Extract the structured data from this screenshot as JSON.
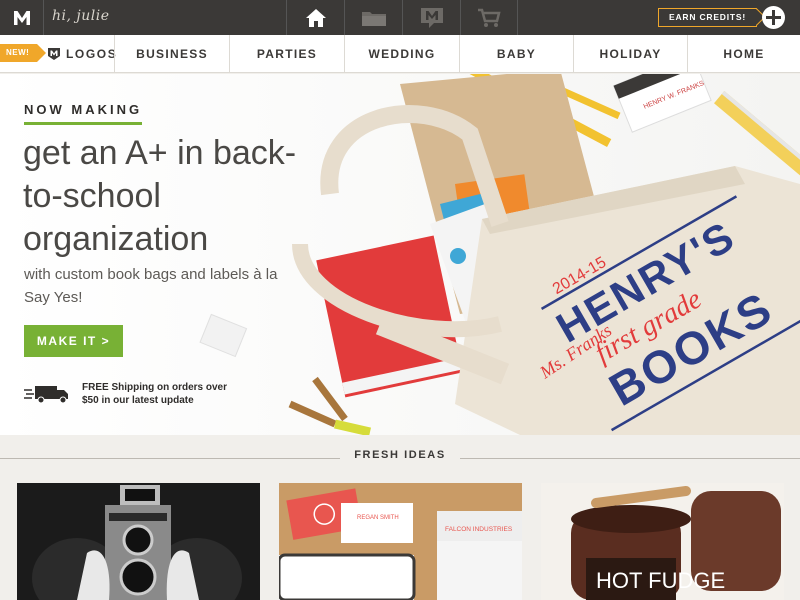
{
  "header": {
    "greeting": "hi, julie",
    "earn_credits": "EARN CREDITS!",
    "icons": [
      "home-icon",
      "folder-icon",
      "message-icon",
      "cart-icon"
    ]
  },
  "nav": {
    "new_badge": "NEW!",
    "logos_label": "LOGOS",
    "items": [
      "BUSINESS",
      "PARTIES",
      "WEDDING",
      "BABY",
      "HOLIDAY",
      "HOME"
    ]
  },
  "hero": {
    "eyebrow": "NOW MAKING",
    "headline": "get an A+ in back-to-school organization",
    "subtext": "with custom book bags and labels à la Say Yes!",
    "cta": "MAKE IT >",
    "shipping": "FREE Shipping on orders over $50 in our latest update",
    "bag_year": "2014-15",
    "bag_name": "HENRY'S",
    "bag_grade": "first grade",
    "bag_books": "BOOKS",
    "bag_teacher": "Ms. Franks"
  },
  "fresh": {
    "title": "FRESH IDEAS",
    "card2_brand": "FALCON INDUSTRIES",
    "card2_name": "REGAN SMITH",
    "card3_title": "HOT FUDGE"
  },
  "colors": {
    "topbar": "#3b3937",
    "accent_green": "#78b135",
    "accent_orange": "#f0a72a",
    "red": "#e23b3b",
    "navy": "#2d3e86"
  }
}
